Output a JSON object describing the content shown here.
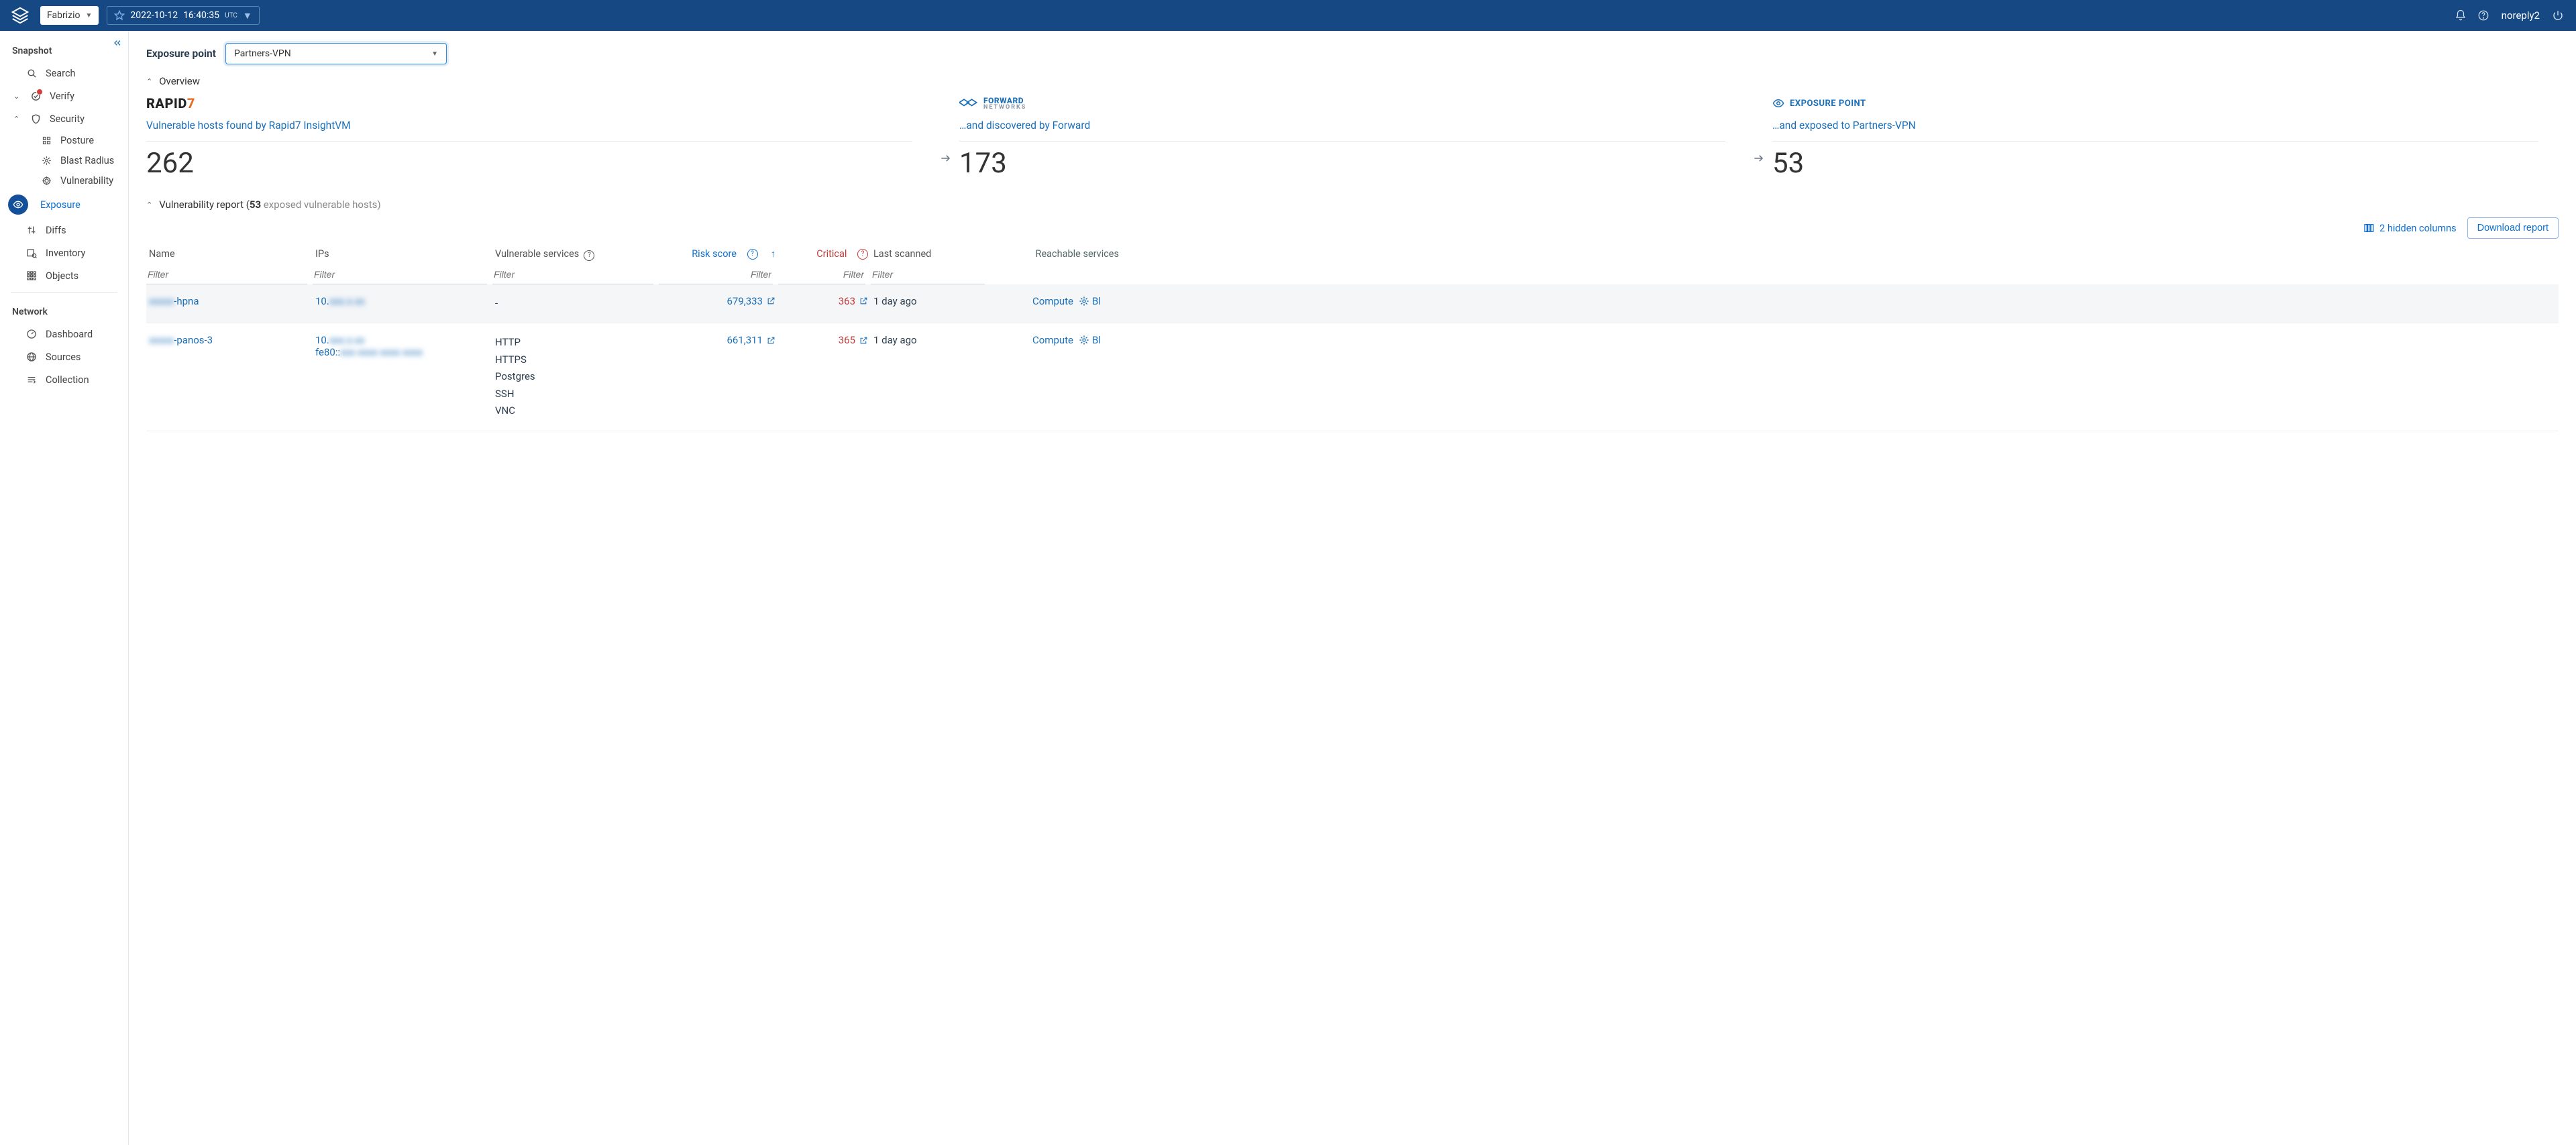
{
  "topbar": {
    "tenant": "Fabrizio",
    "date": "2022-10-12",
    "time": "16:40:35",
    "tz": "UTC",
    "user": "noreply2"
  },
  "sidebar": {
    "sections": {
      "snapshot": "Snapshot",
      "network": "Network"
    },
    "items": {
      "search": "Search",
      "verify": "Verify",
      "security": "Security",
      "posture": "Posture",
      "blast": "Blast Radius",
      "vuln": "Vulnerability",
      "exposure": "Exposure",
      "diffs": "Diffs",
      "inventory": "Inventory",
      "objects": "Objects",
      "dashboard": "Dashboard",
      "sources": "Sources",
      "collection": "Collection"
    }
  },
  "exposure": {
    "label": "Exposure point",
    "selected": "Partners-VPN",
    "overview": "Overview",
    "cards": {
      "rapid7_title": "Vulnerable hosts found by Rapid7 InsightVM",
      "rapid7_count": "262",
      "forward_title": "…and discovered by Forward",
      "forward_count": "173",
      "exposed_tag": "EXPOSURE POINT",
      "exposed_title": "…and exposed to Partners-VPN",
      "exposed_count": "53"
    },
    "report": {
      "prefix": "Vulnerability report (",
      "count": "53",
      "suffix": " exposed vulnerable hosts)"
    },
    "hidden_columns": "2 hidden columns",
    "download": "Download report",
    "columns": {
      "name": "Name",
      "ips": "IPs",
      "services": "Vulnerable services",
      "risk": "Risk score",
      "critical": "Critical",
      "scanned": "Last scanned",
      "reachable": "Reachable services"
    },
    "filter_placeholder": "Filter",
    "rows": [
      {
        "name_blur": "xxxxx",
        "name_rest": "-hpna",
        "ip_prefix": "10.",
        "ip_blur": "xxx.x.xx",
        "ip2_prefix": "",
        "ip2_blur": "",
        "services": [
          "-"
        ],
        "risk": "679,333",
        "critical": "363",
        "scanned": "1 day ago",
        "compute": "Compute",
        "blast": "Bl"
      },
      {
        "name_blur": "xxxxx",
        "name_rest": "-panos-3",
        "ip_prefix": "10.",
        "ip_blur": "xxx.x.xx",
        "ip2_prefix": "fe80::",
        "ip2_blur": "xxx xxxx xxxx xxxx",
        "services": [
          "HTTP",
          "HTTPS",
          "Postgres",
          "SSH",
          "VNC"
        ],
        "risk": "661,311",
        "critical": "365",
        "scanned": "1 day ago",
        "compute": "Compute",
        "blast": "Bl"
      }
    ]
  }
}
